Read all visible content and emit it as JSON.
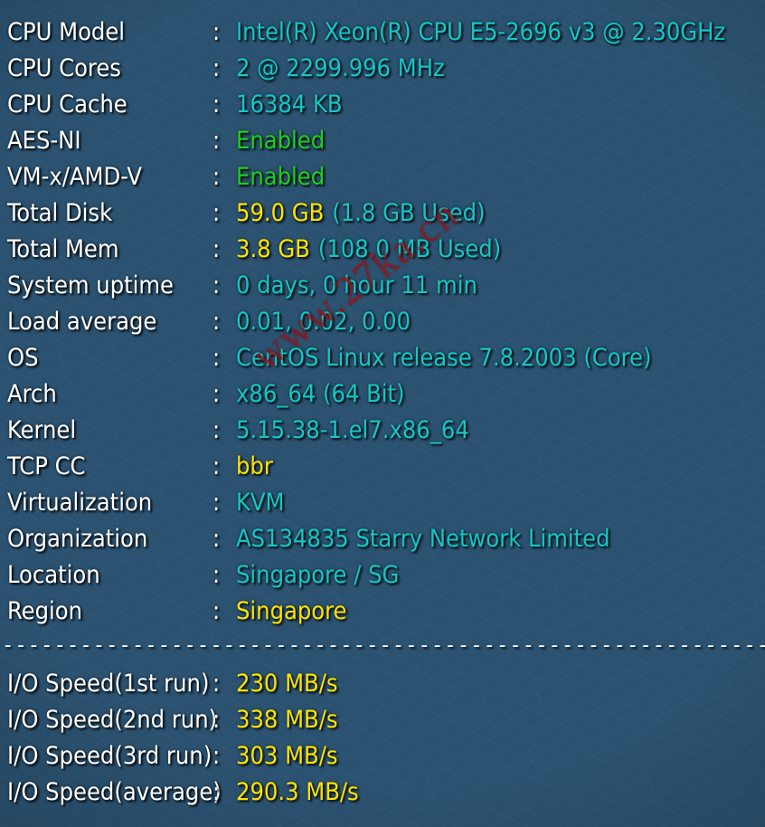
{
  "watermark": {
    "text": "www.27ka.cn"
  },
  "separator": {
    "text": "----------------------------------------------------------------------",
    "char": "-"
  },
  "colon": ":",
  "colors": {
    "background_dark": "#1a2430",
    "background_light": "#2d5875",
    "label": "#ffffff",
    "value_cyan": "#15c6c6",
    "value_green": "#21cc21",
    "value_yellow": "#ffe400",
    "watermark": "#96161e"
  },
  "system_info": [
    {
      "label": "CPU Model",
      "value": "Intel(R) Xeon(R) CPU E5-2696 v3 @ 2.30GHz",
      "color": "cyan",
      "extra": ""
    },
    {
      "label": "CPU Cores",
      "value": "2 @ 2299.996 MHz",
      "color": "cyan",
      "extra": ""
    },
    {
      "label": "CPU Cache",
      "value": "16384 KB",
      "color": "cyan",
      "extra": ""
    },
    {
      "label": "AES-NI",
      "value": "Enabled",
      "color": "green",
      "extra": ""
    },
    {
      "label": "VM-x/AMD-V",
      "value": "Enabled",
      "color": "green",
      "extra": ""
    },
    {
      "label": "Total Disk",
      "value": "59.0 GB",
      "color": "yellow",
      "extra": "(1.8 GB Used)"
    },
    {
      "label": "Total Mem",
      "value": "3.8 GB",
      "color": "yellow",
      "extra": "(108.0 MB Used)"
    },
    {
      "label": "System uptime",
      "value": "0 days, 0 hour 11 min",
      "color": "cyan",
      "extra": ""
    },
    {
      "label": "Load average",
      "value": "0.01, 0.02, 0.00",
      "color": "cyan",
      "extra": ""
    },
    {
      "label": "OS",
      "value": "CentOS Linux release 7.8.2003 (Core)",
      "color": "cyan",
      "extra": ""
    },
    {
      "label": "Arch",
      "value": "x86_64 (64 Bit)",
      "color": "cyan",
      "extra": ""
    },
    {
      "label": "Kernel",
      "value": "5.15.38-1.el7.x86_64",
      "color": "cyan",
      "extra": ""
    },
    {
      "label": "TCP CC",
      "value": "bbr",
      "color": "yellow",
      "extra": ""
    },
    {
      "label": "Virtualization",
      "value": "KVM",
      "color": "cyan",
      "extra": ""
    },
    {
      "label": "Organization",
      "value": "AS134835 Starry Network Limited",
      "color": "cyan",
      "extra": ""
    },
    {
      "label": "Location",
      "value": "Singapore / SG",
      "color": "cyan",
      "extra": ""
    },
    {
      "label": "Region",
      "value": "Singapore",
      "color": "yellow",
      "extra": ""
    }
  ],
  "io_speed": [
    {
      "label": "I/O Speed(1st run)",
      "value": "230 MB/s",
      "color": "yellow",
      "extra": ""
    },
    {
      "label": "I/O Speed(2nd run)",
      "value": "338 MB/s",
      "color": "yellow",
      "extra": ""
    },
    {
      "label": "I/O Speed(3rd run)",
      "value": "303 MB/s",
      "color": "yellow",
      "extra": ""
    },
    {
      "label": "I/O Speed(average)",
      "value": "290.3 MB/s",
      "color": "yellow",
      "extra": ""
    }
  ]
}
